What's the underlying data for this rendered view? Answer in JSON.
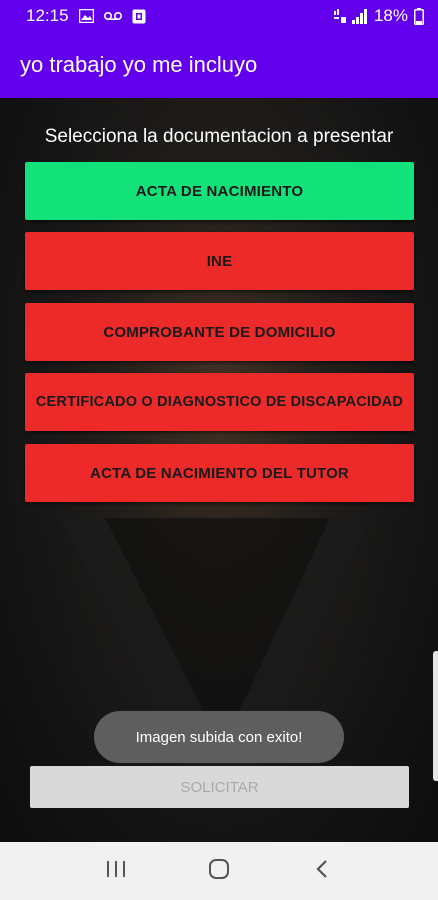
{
  "status_bar": {
    "time": "12:15",
    "battery": "18%",
    "icons": [
      "gallery-icon",
      "voicemail-icon",
      "app-notification-icon",
      "wifi-calling-icon",
      "signal-icon",
      "battery-icon"
    ]
  },
  "app_bar": {
    "title": "yo trabajo yo me incluyo"
  },
  "main": {
    "heading": "Selecciona la documentacion a presentar",
    "buttons": [
      {
        "label": "ACTA DE NACIMIENTO",
        "status": "uploaded",
        "color": "#13e27a"
      },
      {
        "label": "INE",
        "status": "pending",
        "color": "#ec2a2a"
      },
      {
        "label": "COMPROBANTE DE DOMICILIO",
        "status": "pending",
        "color": "#ec2a2a"
      },
      {
        "label": "CERTIFICADO O DIAGNOSTICO DE DISCAPACIDAD",
        "status": "pending",
        "color": "#ec2a2a"
      },
      {
        "label": "ACTA DE NACIMIENTO DEL TUTOR",
        "status": "pending",
        "color": "#ec2a2a"
      }
    ],
    "submit_label": "SOLICITAR"
  },
  "toast": {
    "message": "Imagen subida con exito!"
  },
  "nav_bar": {
    "icons": [
      "recent-apps-icon",
      "home-icon",
      "back-icon"
    ]
  },
  "colors": {
    "primary": "#6200ee",
    "uploaded": "#13e27a",
    "pending": "#ec2a2a"
  }
}
